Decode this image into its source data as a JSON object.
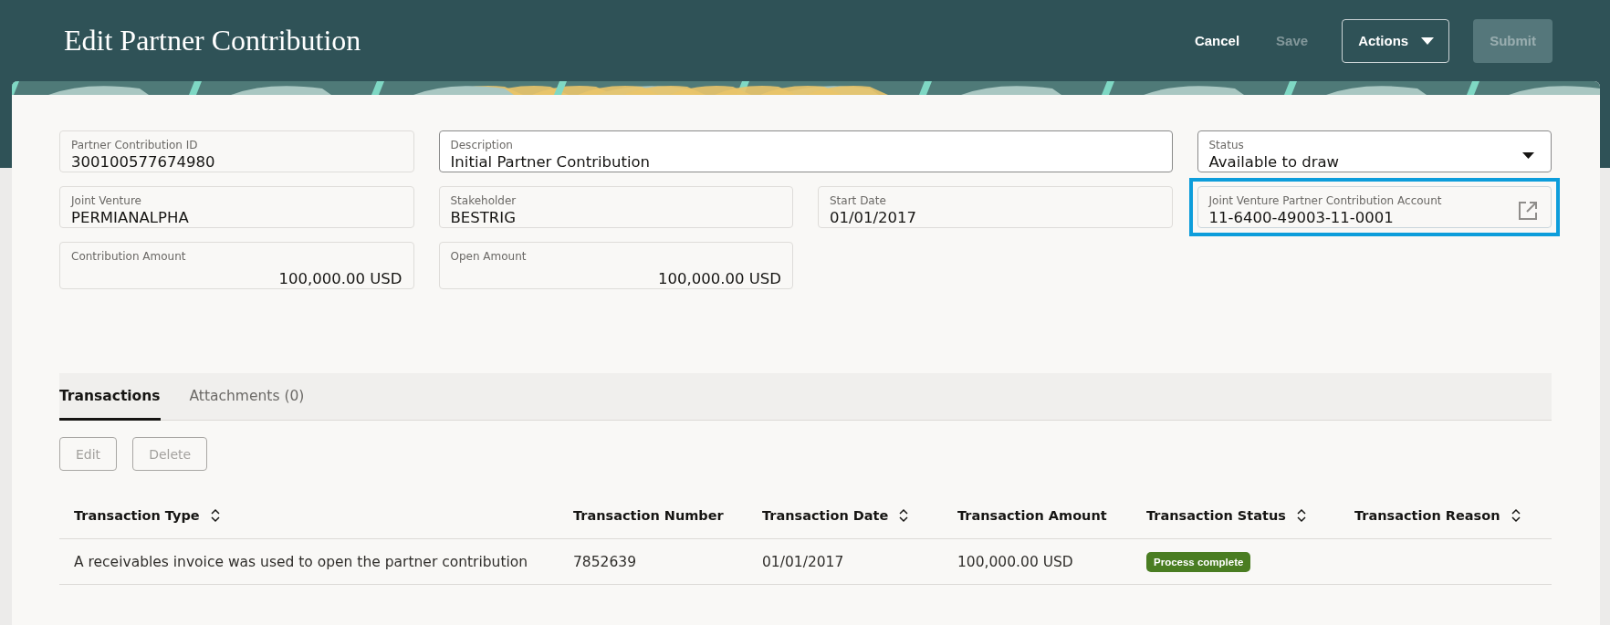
{
  "header": {
    "title": "Edit Partner Contribution",
    "actions": [
      {
        "label": "Cancel",
        "kind": "link",
        "disabled": false
      },
      {
        "label": "Save",
        "kind": "link",
        "disabled": true
      },
      {
        "label": "Actions",
        "kind": "menu",
        "disabled": false
      },
      {
        "label": "Submit",
        "kind": "primary",
        "disabled": true
      }
    ]
  },
  "form": {
    "fields": [
      {
        "label": "Partner Contribution ID",
        "value": "300100577674980",
        "kind": "readonly",
        "highlighted": false
      },
      {
        "label": "Description",
        "value": "Initial Partner Contribution",
        "kind": "text",
        "highlighted": false
      },
      {
        "label": "Status",
        "value": "Available to draw",
        "kind": "select",
        "highlighted": false
      },
      {
        "label": "Joint Venture",
        "value": "PERMIANALPHA",
        "kind": "readonly",
        "highlighted": false
      },
      {
        "label": "Stakeholder",
        "value": "BESTRIG",
        "kind": "readonly",
        "highlighted": false
      },
      {
        "label": "Start Date",
        "value": "01/01/2017",
        "kind": "readonly",
        "highlighted": false
      },
      {
        "label": "Joint Venture Partner Contribution Account",
        "value": "11-6400-49003-11-0001",
        "kind": "link",
        "highlighted": true
      },
      {
        "label": "Contribution Amount",
        "value": "100,000.00 USD",
        "kind": "amount",
        "highlighted": false
      },
      {
        "label": "Open Amount",
        "value": "100,000.00 USD",
        "kind": "amount",
        "highlighted": false
      }
    ]
  },
  "tabs": [
    {
      "label": "Transactions",
      "selected": true
    },
    {
      "label": "Attachments (0)",
      "selected": false
    }
  ],
  "toolbar": [
    {
      "label": "Edit",
      "disabled": true
    },
    {
      "label": "Delete",
      "disabled": true
    }
  ],
  "table": {
    "columns": [
      {
        "label": "Transaction Type",
        "sortable": true
      },
      {
        "label": "Transaction Number",
        "sortable": false
      },
      {
        "label": "Transaction Date",
        "sortable": true
      },
      {
        "label": "Transaction Amount",
        "sortable": false
      },
      {
        "label": "Transaction Status",
        "sortable": true
      },
      {
        "label": "Transaction Reason",
        "sortable": true
      }
    ],
    "rows": [
      {
        "cells": [
          {
            "kind": "text",
            "text": "A receivables invoice was used to open the partner contribution"
          },
          {
            "kind": "text",
            "text": "7852639"
          },
          {
            "kind": "text",
            "text": "01/01/2017"
          },
          {
            "kind": "text",
            "text": "100,000.00 USD"
          },
          {
            "kind": "badge",
            "text": "Process complete",
            "color": "#4a7d22"
          }
        ]
      }
    ]
  }
}
